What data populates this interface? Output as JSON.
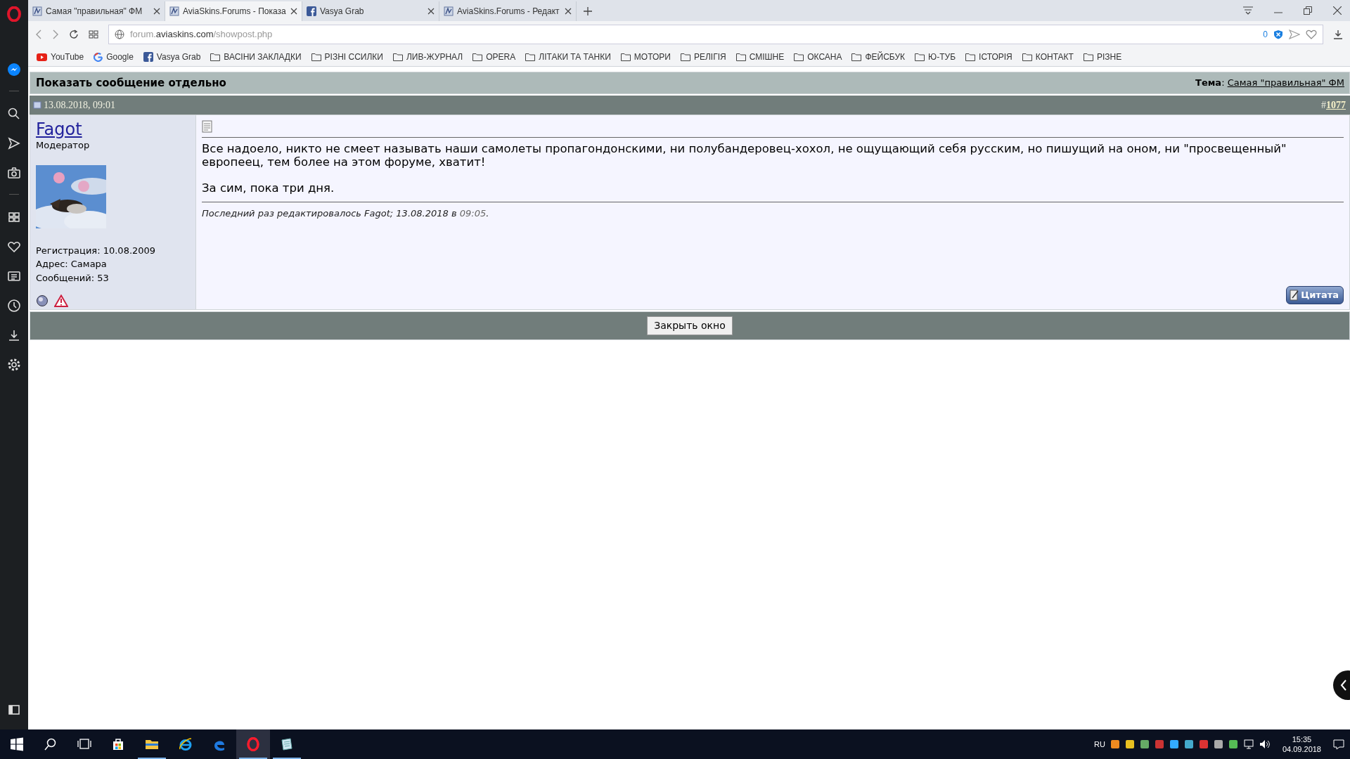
{
  "browser": {
    "tabs": [
      {
        "title": "Самая \"правильная\" ФМ",
        "kind": "site",
        "selected": false
      },
      {
        "title": "AviaSkins.Forums - Показа",
        "kind": "site",
        "selected": true
      },
      {
        "title": "Vasya Grab",
        "kind": "facebook",
        "selected": false
      },
      {
        "title": "AviaSkins.Forums - Редакт",
        "kind": "site",
        "selected": false
      }
    ],
    "address": {
      "prefix": "forum.",
      "domain": "aviaskins.com",
      "path": "/showpost.php"
    },
    "blocked_count": "0",
    "bookmarks": [
      {
        "label": "YouTube",
        "kind": "youtube"
      },
      {
        "label": "Google",
        "kind": "google"
      },
      {
        "label": "Vasya Grab",
        "kind": "facebook"
      },
      {
        "label": "ВАСІНИ ЗАКЛАДКИ",
        "kind": "folder"
      },
      {
        "label": "РІЗНІ ССИЛКИ",
        "kind": "folder"
      },
      {
        "label": "ЛИВ-ЖУРНАЛ",
        "kind": "folder"
      },
      {
        "label": "OPERA",
        "kind": "folder"
      },
      {
        "label": "ЛІТАКИ ТА ТАНКИ",
        "kind": "folder"
      },
      {
        "label": "МОТОРИ",
        "kind": "folder"
      },
      {
        "label": "РЕЛІГІЯ",
        "kind": "folder"
      },
      {
        "label": "СМІШНЕ",
        "kind": "folder"
      },
      {
        "label": "ОКСАНА",
        "kind": "folder"
      },
      {
        "label": "ФЕЙСБУК",
        "kind": "folder"
      },
      {
        "label": "Ю-ТУБ",
        "kind": "folder"
      },
      {
        "label": "ІСТОРІЯ",
        "kind": "folder"
      },
      {
        "label": "КОНТАКТ",
        "kind": "folder"
      },
      {
        "label": "РІЗНЕ",
        "kind": "folder"
      }
    ]
  },
  "page": {
    "title": "Показать сообщение отдельно",
    "topic_label": "**Тема**:",
    "topic": "Самая \"правильная\" ФМ",
    "post": {
      "date": "13.08.2018, 09:01",
      "number_prefix": "#",
      "number": "1077",
      "user": {
        "name": "Fagot",
        "rank": "Модератор",
        "online": false,
        "details": [
          "Регистрация: 10.08.2009",
          "Адрес: Самара",
          "Сообщений: 53"
        ]
      },
      "paragraphs": [
        "Все надоело, никто не смеет называть наши самолеты пропагондонскими, ни полубандеровец-хохол, не ощущающий себя русским, но пишущий на оном, ни \"просвещенный\" европеец, тем более на этом форуме, хватит!",
        "За сим, пока три дня."
      ],
      "edit_note": {
        "text": "Последний раз редактировалось Fagot; 13.08.2018 в",
        "time": "09:05",
        "end": "."
      },
      "quote_button": "Цитата"
    },
    "close_button": "Закрыть окно"
  },
  "taskbar": {
    "apps": [
      {
        "kind": "store",
        "running": false,
        "active": false
      },
      {
        "kind": "explorer",
        "running": true,
        "active": false
      },
      {
        "kind": "ie",
        "running": false,
        "active": false
      },
      {
        "kind": "edge",
        "running": false,
        "active": false
      },
      {
        "kind": "opera",
        "running": true,
        "active": true
      },
      {
        "kind": "notes",
        "running": true,
        "active": false
      }
    ],
    "language": "RU",
    "time": "15:35",
    "date": "04.09.2018"
  }
}
